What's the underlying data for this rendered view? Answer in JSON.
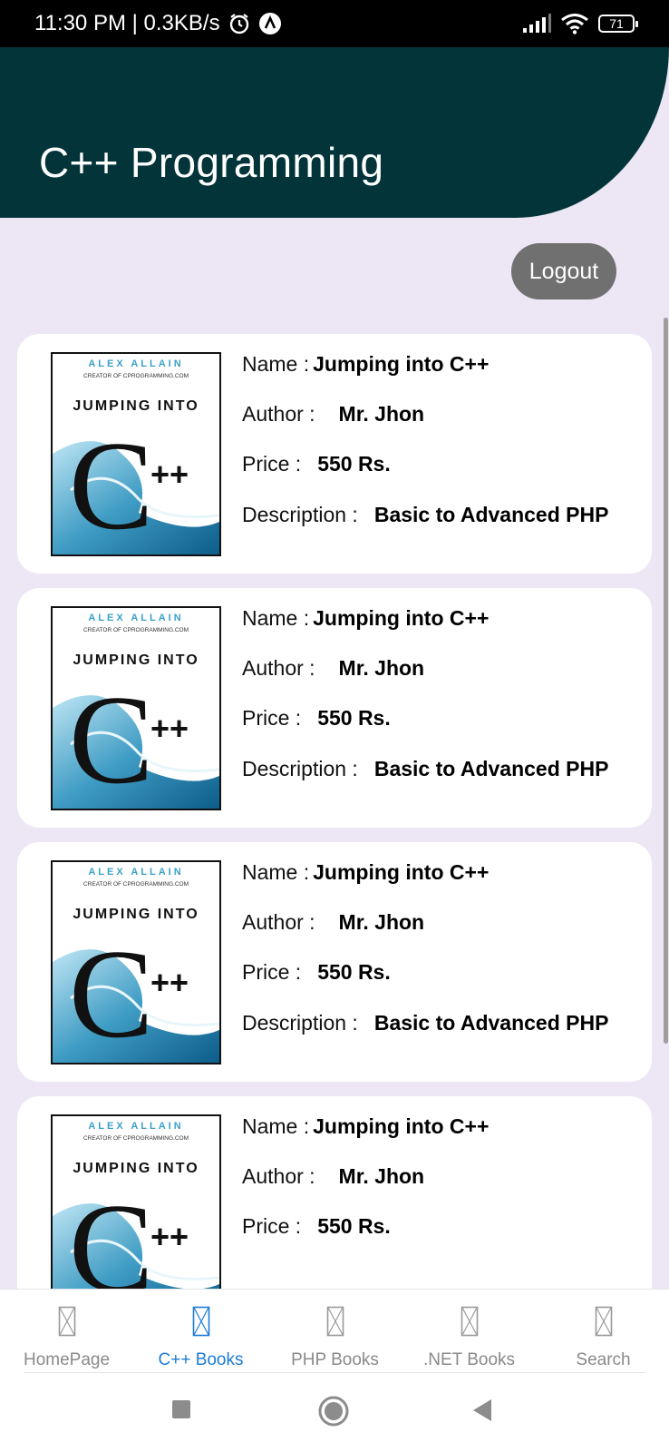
{
  "status_bar": {
    "time_speed": "11:30 PM | 0.3KB/s",
    "battery": "71"
  },
  "header": {
    "title": "C++ Programming"
  },
  "actions": {
    "logout_label": "Logout"
  },
  "book_labels": {
    "name": "Name :",
    "author": "Author :",
    "price": "Price :",
    "description": "Description :"
  },
  "cover": {
    "author_name": "ALEX ALLAIN",
    "tagline": "CREATOR OF CPROGRAMMING.COM",
    "title_line": "JUMPING INTO",
    "big_letter": "C",
    "plus": "++"
  },
  "books": [
    {
      "name": "Jumping into C++",
      "author": "Mr. Jhon",
      "price": "550 Rs.",
      "description": "Basic to Advanced PHP"
    },
    {
      "name": "Jumping into C++",
      "author": "Mr. Jhon",
      "price": "550 Rs.",
      "description": "Basic to Advanced PHP"
    },
    {
      "name": "Jumping into C++",
      "author": "Mr. Jhon",
      "price": "550 Rs.",
      "description": "Basic to Advanced PHP"
    },
    {
      "name": "Jumping into C++",
      "author": "Mr. Jhon",
      "price": "550 Rs."
    }
  ],
  "bottom_nav": {
    "items": [
      {
        "label": "HomePage",
        "icon": "broken-image-icon"
      },
      {
        "label": "C++ Books",
        "icon": "broken-image-icon",
        "active": true
      },
      {
        "label": "PHP Books",
        "icon": "broken-image-icon"
      },
      {
        "label": ".NET Books",
        "icon": "broken-image-icon"
      },
      {
        "label": "Search",
        "icon": "broken-image-icon"
      }
    ]
  },
  "colors": {
    "header_bg": "#02343a",
    "page_bg": "#ece6f5",
    "active_nav": "#1e7bd6",
    "logout_bg": "#707070"
  }
}
